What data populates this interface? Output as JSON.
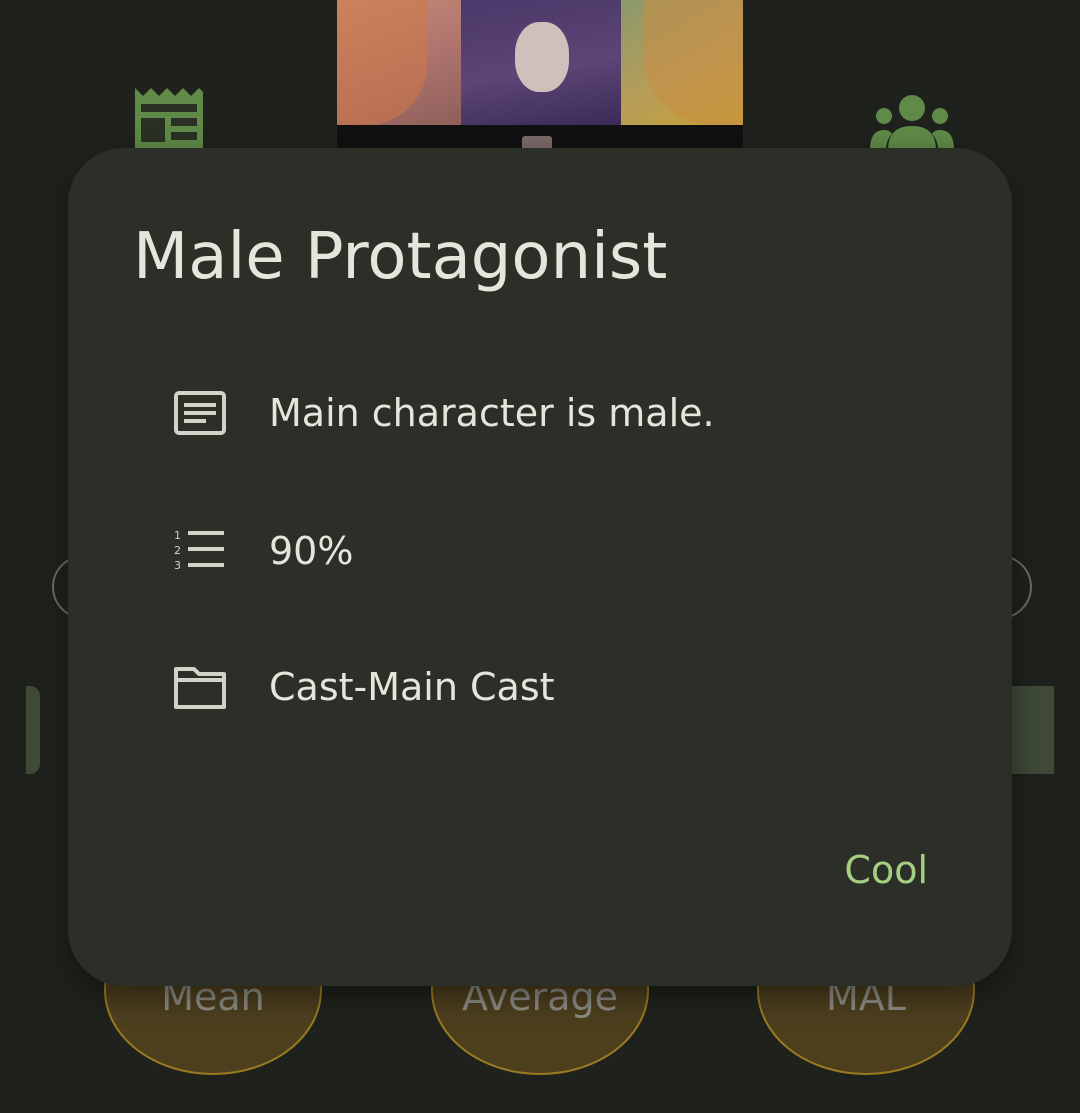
{
  "background": {
    "stats": [
      {
        "label": "Mean"
      },
      {
        "label": "Average"
      },
      {
        "label": "MAL"
      }
    ]
  },
  "dialog": {
    "title": "Male Protagonist",
    "description": "Main character is male.",
    "rank": "90%",
    "category": "Cast-Main Cast",
    "confirm_label": "Cool"
  },
  "colors": {
    "accent": "#a6cf82",
    "dialog_bg": "#2b2f27",
    "screen_bg": "#1f221c",
    "text": "#e4e6dc",
    "icon_green": "#6a9650",
    "stat_fill": "#4d3f1e",
    "stat_border": "#9b7a22"
  },
  "icons": {
    "description": "notes-icon",
    "rank": "format-list-numbered-icon",
    "category": "folder-icon"
  }
}
